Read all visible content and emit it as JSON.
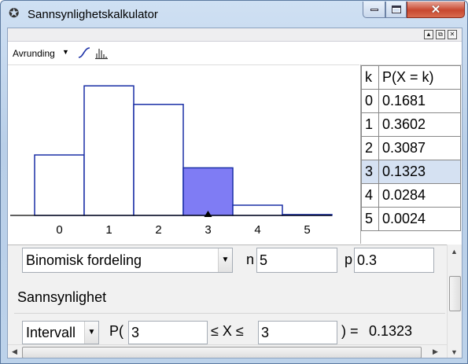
{
  "window": {
    "title": "Sannsynlighetskalkulator",
    "app_icon": "geogebra-icon",
    "controls": [
      "minimize-icon",
      "maximize-icon",
      "close-icon"
    ]
  },
  "toolbar": {
    "rounding_label": "Avrunding",
    "cumulative_icon": "cumulative-curve-icon",
    "histogram_icon": "histogram-icon"
  },
  "chart_data": {
    "type": "bar",
    "categories": [
      "0",
      "1",
      "2",
      "3",
      "4",
      "5"
    ],
    "values": [
      0.1681,
      0.3602,
      0.3087,
      0.1323,
      0.0284,
      0.0024
    ],
    "highlighted": [
      "3"
    ],
    "xlabel": "",
    "ylabel": "",
    "ylim": [
      0,
      0.4
    ],
    "grid": false,
    "colors": {
      "bar_stroke": "#1a2fa6",
      "bar_fill": "#ffffff",
      "highlight_fill": "#7f7cf4"
    },
    "marker": "3"
  },
  "table": {
    "headers": [
      "k",
      "P(X = k)"
    ],
    "rows": [
      [
        "0",
        "0.1681"
      ],
      [
        "1",
        "0.3602"
      ],
      [
        "2",
        "0.3087"
      ],
      [
        "3",
        "0.1323"
      ],
      [
        "4",
        "0.0284"
      ],
      [
        "5",
        "0.0024"
      ]
    ],
    "selected_row": "3"
  },
  "distribution": {
    "selected": "Binomisk fordeling",
    "n_label": "n",
    "n_value": "5",
    "p_label": "p",
    "p_value": "0.3"
  },
  "probability": {
    "section_title": "Sannsynlighet",
    "mode": "Intervall",
    "p_open": "P(",
    "lower": "3",
    "middle": "≤ X ≤",
    "upper": "3",
    "close_eq": ") =",
    "result": "0.1323"
  },
  "colors": {
    "selection": "#d5e1f2",
    "bar_highlight": "#7f7cf4"
  }
}
